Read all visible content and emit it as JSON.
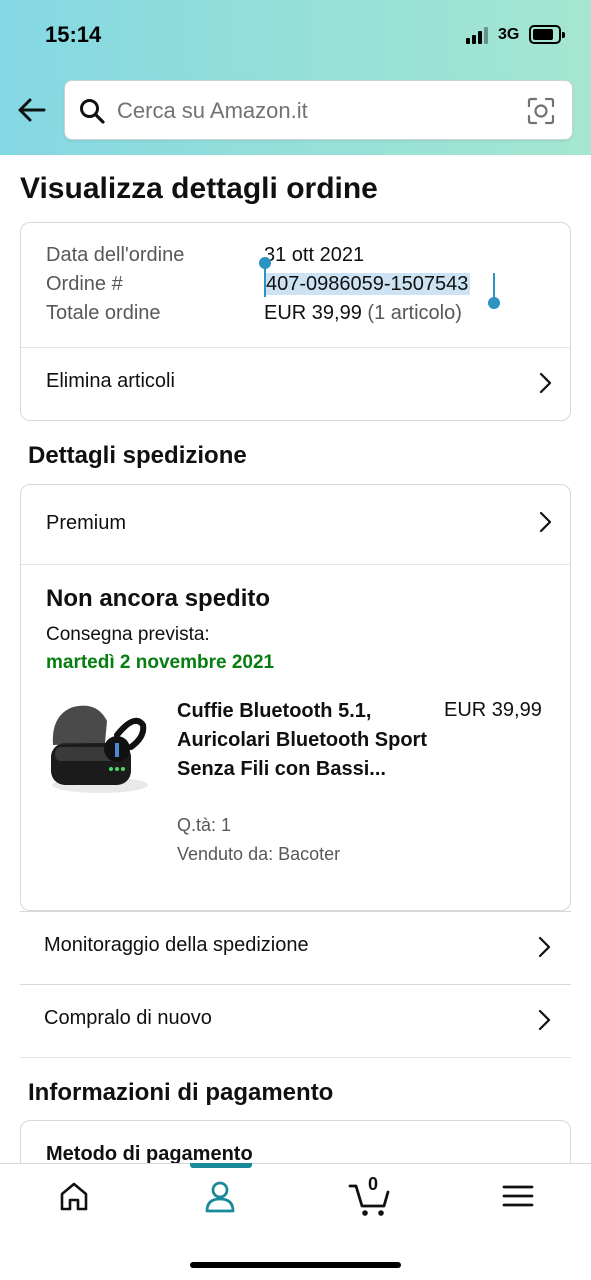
{
  "status_bar": {
    "time": "15:14",
    "network": "3G"
  },
  "search": {
    "placeholder": "Cerca su Amazon.it"
  },
  "page_title": "Visualizza dettagli ordine",
  "order": {
    "date_label": "Data dell'ordine",
    "date_value": "31 ott 2021",
    "number_label": "Ordine #",
    "number_value": "407-0986059-1507543",
    "total_label": "Totale ordine",
    "total_value": "EUR 39,99",
    "total_items": "(1 articolo)",
    "delete_items_label": "Elimina articoli"
  },
  "shipping": {
    "section_title": "Dettagli spedizione",
    "service": "Premium",
    "status": "Non ancora spedito",
    "delivery_label": "Consegna prevista:",
    "delivery_date": "martedì 2 novembre 2021",
    "item": {
      "name": "Cuffie Bluetooth 5.1, Auricolari Bluetooth Sport Senza Fili con Bassi...",
      "price": "EUR 39,99",
      "quantity": "Q.tà: 1",
      "seller": "Venduto da: Bacoter"
    },
    "track_label": "Monitoraggio della spedizione",
    "buy_again_label": "Compralo di nuovo"
  },
  "payment": {
    "section_title": "Informazioni di pagamento",
    "method_label": "Metodo di pagamento"
  },
  "tab_bar": {
    "items": [
      "home-icon",
      "account-icon",
      "cart-icon",
      "menu-icon"
    ],
    "active": "account-icon",
    "cart_count": "0",
    "accent_color": "#1a8a9a"
  },
  "colors": {
    "delivery_green": "#067d0f",
    "selection": "#cde3f3",
    "selection_handle": "#2c93c2"
  }
}
